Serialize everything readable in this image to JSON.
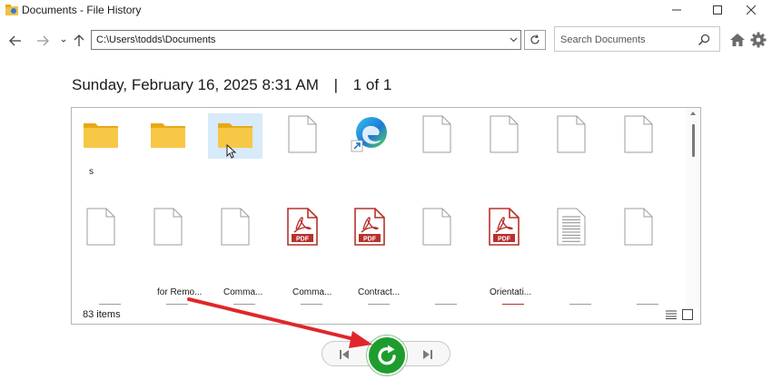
{
  "window": {
    "title": "Documents - File History"
  },
  "nav": {
    "address": "C:\\Users\\todds\\Documents",
    "search_placeholder": "Search Documents"
  },
  "snapshot": {
    "datetime": "Sunday, February 16, 2025 8:31 AM",
    "separator": "|",
    "position": "1 of 1"
  },
  "files": {
    "row1": [
      {
        "kind": "folder"
      },
      {
        "kind": "folder"
      },
      {
        "kind": "folder",
        "selected": true
      },
      {
        "kind": "file"
      },
      {
        "kind": "edge-shortcut"
      },
      {
        "kind": "file"
      },
      {
        "kind": "file"
      },
      {
        "kind": "file"
      },
      {
        "kind": "file"
      }
    ],
    "row1_stray_label": "s",
    "row2": [
      {
        "kind": "file"
      },
      {
        "kind": "file"
      },
      {
        "kind": "file"
      },
      {
        "kind": "pdf"
      },
      {
        "kind": "pdf"
      },
      {
        "kind": "file"
      },
      {
        "kind": "pdf"
      },
      {
        "kind": "text"
      },
      {
        "kind": "file"
      }
    ],
    "pdf_badge": "PDF",
    "row2_labels": [
      "for Remo...",
      "Comma...",
      "Comma...",
      "Contract...",
      "Orientati..."
    ]
  },
  "status": {
    "item_count": "83 items"
  },
  "colors": {
    "folder": "#f7c846",
    "folder_dark": "#e8a917",
    "pdf_red": "#b7312c",
    "restore_green": "#1f9c2e",
    "arrow_red": "#e0262a",
    "selection": "#d7ebfa"
  },
  "icons": {
    "back": "arrow-left-icon",
    "forward": "arrow-right-icon",
    "up": "arrow-up-icon",
    "refresh": "refresh-icon",
    "search": "search-icon",
    "home": "home-icon",
    "settings": "gear-icon",
    "restore": "restore-icon",
    "previous": "skip-previous-icon",
    "next": "skip-next-icon"
  }
}
